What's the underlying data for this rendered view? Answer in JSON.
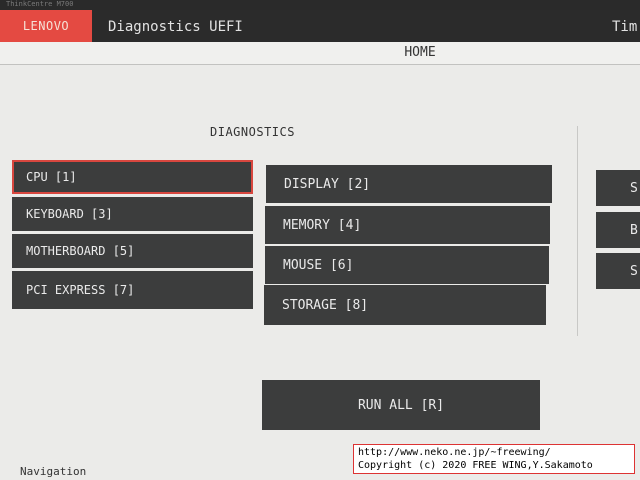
{
  "header": {
    "strip_text": "ThinkCentre M700",
    "brand": "LENOVO",
    "title": "Diagnostics UEFI",
    "right_label": "Tim"
  },
  "page": {
    "title": "HOME"
  },
  "section": {
    "title": "DIAGNOSTICS"
  },
  "tiles": {
    "col1": [
      "CPU [1]",
      "KEYBOARD [3]",
      "MOTHERBOARD [5]",
      "PCI EXPRESS [7]"
    ],
    "col2": [
      "DISPLAY [2]",
      "MEMORY [4]",
      "MOUSE [6]",
      "STORAGE [8]"
    ],
    "selected": "CPU [1]"
  },
  "run_all": {
    "label": "RUN ALL [R]"
  },
  "side_buttons": [
    "S",
    "B",
    "S"
  ],
  "footer": {
    "nav_text": "Navigation"
  },
  "watermark": {
    "line1": "http://www.neko.ne.jp/~freewing/",
    "line2": "Copyright (c) 2020 FREE WING,Y.Sakamoto"
  },
  "colors": {
    "accent": "#e44a42",
    "tile": "#3c3d3d",
    "header": "#2b2b2b",
    "background": "#ebebe9"
  }
}
